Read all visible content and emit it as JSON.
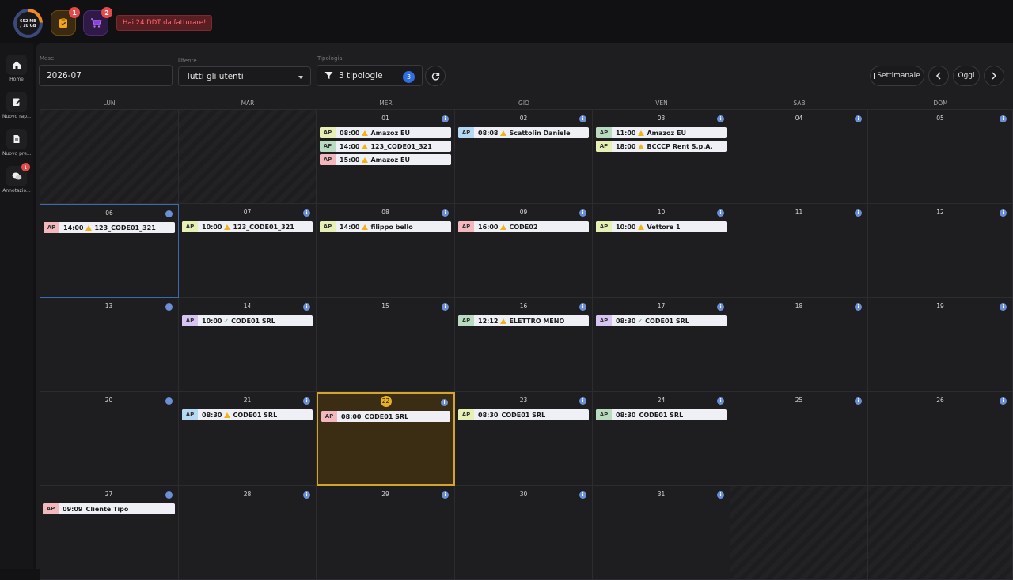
{
  "topbar": {
    "storage_used": "652 MB",
    "storage_total": "/ 10 GB",
    "orders_badge": "1",
    "cart_badge": "2",
    "alert_text": "Hai 24 DDT da fatturare!"
  },
  "sidebar": {
    "items": [
      {
        "label": "Home",
        "icon": "home-icon"
      },
      {
        "label": "Nuovo rap...",
        "icon": "report-icon"
      },
      {
        "label": "Nuovo pre...",
        "icon": "document-icon"
      },
      {
        "label": "Annotazio...",
        "icon": "chat-icon",
        "badge": "1"
      }
    ]
  },
  "filters": {
    "month_label": "Mese",
    "month_value": "2026-07",
    "user_label": "Utente",
    "user_value": "Tutti gli utenti",
    "type_label": "Tipologia",
    "type_value": "3 tipologie",
    "type_count": "3"
  },
  "toolbar": {
    "view_label": "Settimanale",
    "today_label": "Oggi"
  },
  "calendar": {
    "weekdays": [
      "LUN",
      "MAR",
      "MER",
      "GIO",
      "VEN",
      "SAB",
      "DOM"
    ],
    "today": "22",
    "selected": "06",
    "colors": {
      "red": "#f2b8bd",
      "green": "#b9dcc0",
      "yellow": "#e6efb4",
      "blue": "#b5d9f2",
      "purple": "#d7c4f2"
    },
    "weeks": [
      [
        {
          "day": "",
          "out": true,
          "events": []
        },
        {
          "day": "",
          "out": true,
          "events": []
        },
        {
          "day": "01",
          "events": [
            {
              "tag": "AP",
              "color": "yellow",
              "time": "08:00",
              "status": "warn",
              "title": "Amazoz EU"
            },
            {
              "tag": "AP",
              "color": "green",
              "time": "14:00",
              "status": "warn",
              "title": "123_CODE01_321"
            },
            {
              "tag": "AP",
              "color": "red",
              "time": "15:00",
              "status": "warn",
              "title": "Amazoz EU"
            }
          ]
        },
        {
          "day": "02",
          "events": [
            {
              "tag": "AP",
              "color": "blue",
              "time": "08:08",
              "status": "warn",
              "title": "Scattolin Daniele"
            }
          ]
        },
        {
          "day": "03",
          "events": [
            {
              "tag": "AP",
              "color": "green",
              "time": "11:00",
              "status": "warn",
              "title": "Amazoz EU"
            },
            {
              "tag": "AP",
              "color": "yellow",
              "time": "18:00",
              "status": "warn",
              "title": "BCCCP Rent S.p.A."
            }
          ]
        },
        {
          "day": "04",
          "events": []
        },
        {
          "day": "05",
          "events": []
        }
      ],
      [
        {
          "day": "06",
          "events": [
            {
              "tag": "AP",
              "color": "red",
              "time": "14:00",
              "status": "warn",
              "title": "123_CODE01_321"
            }
          ]
        },
        {
          "day": "07",
          "events": [
            {
              "tag": "AP",
              "color": "yellow",
              "time": "10:00",
              "status": "warn",
              "title": "123_CODE01_321"
            }
          ]
        },
        {
          "day": "08",
          "events": [
            {
              "tag": "AP",
              "color": "yellow",
              "time": "14:00",
              "status": "warn",
              "title": "filippo bello"
            }
          ]
        },
        {
          "day": "09",
          "events": [
            {
              "tag": "AP",
              "color": "red",
              "time": "16:00",
              "status": "warn",
              "title": "CODE02"
            }
          ]
        },
        {
          "day": "10",
          "events": [
            {
              "tag": "AP",
              "color": "yellow",
              "time": "10:00",
              "status": "warn",
              "title": "Vettore 1"
            }
          ]
        },
        {
          "day": "11",
          "events": []
        },
        {
          "day": "12",
          "events": []
        }
      ],
      [
        {
          "day": "13",
          "events": []
        },
        {
          "day": "14",
          "events": [
            {
              "tag": "AP",
              "color": "purple",
              "time": "10:00",
              "status": "ok",
              "title": "CODE01 SRL"
            }
          ]
        },
        {
          "day": "15",
          "events": []
        },
        {
          "day": "16",
          "events": [
            {
              "tag": "AP",
              "color": "green",
              "time": "12:12",
              "status": "warn",
              "title": "ELETTRO MENO"
            }
          ]
        },
        {
          "day": "17",
          "events": [
            {
              "tag": "AP",
              "color": "purple",
              "time": "08:30",
              "status": "ok",
              "title": "CODE01 SRL"
            }
          ]
        },
        {
          "day": "18",
          "events": []
        },
        {
          "day": "19",
          "events": []
        }
      ],
      [
        {
          "day": "20",
          "events": []
        },
        {
          "day": "21",
          "events": [
            {
              "tag": "AP",
              "color": "blue",
              "time": "08:30",
              "status": "warn",
              "title": "CODE01 SRL"
            }
          ]
        },
        {
          "day": "22",
          "events": [
            {
              "tag": "AP",
              "color": "red",
              "time": "08:00",
              "status": "",
              "title": "CODE01 SRL"
            }
          ]
        },
        {
          "day": "23",
          "events": [
            {
              "tag": "AP",
              "color": "yellow",
              "time": "08:30",
              "status": "",
              "title": "CODE01 SRL"
            }
          ]
        },
        {
          "day": "24",
          "events": [
            {
              "tag": "AP",
              "color": "green",
              "time": "08:30",
              "status": "",
              "title": "CODE01 SRL"
            }
          ]
        },
        {
          "day": "25",
          "events": []
        },
        {
          "day": "26",
          "events": []
        }
      ],
      [
        {
          "day": "27",
          "events": [
            {
              "tag": "AP",
              "color": "red",
              "time": "09:09",
              "status": "",
              "title": "Cliente Tipo"
            }
          ]
        },
        {
          "day": "28",
          "events": []
        },
        {
          "day": "29",
          "events": []
        },
        {
          "day": "30",
          "events": []
        },
        {
          "day": "31",
          "events": []
        },
        {
          "day": "",
          "out": true,
          "events": []
        },
        {
          "day": "",
          "out": true,
          "events": []
        }
      ]
    ]
  }
}
